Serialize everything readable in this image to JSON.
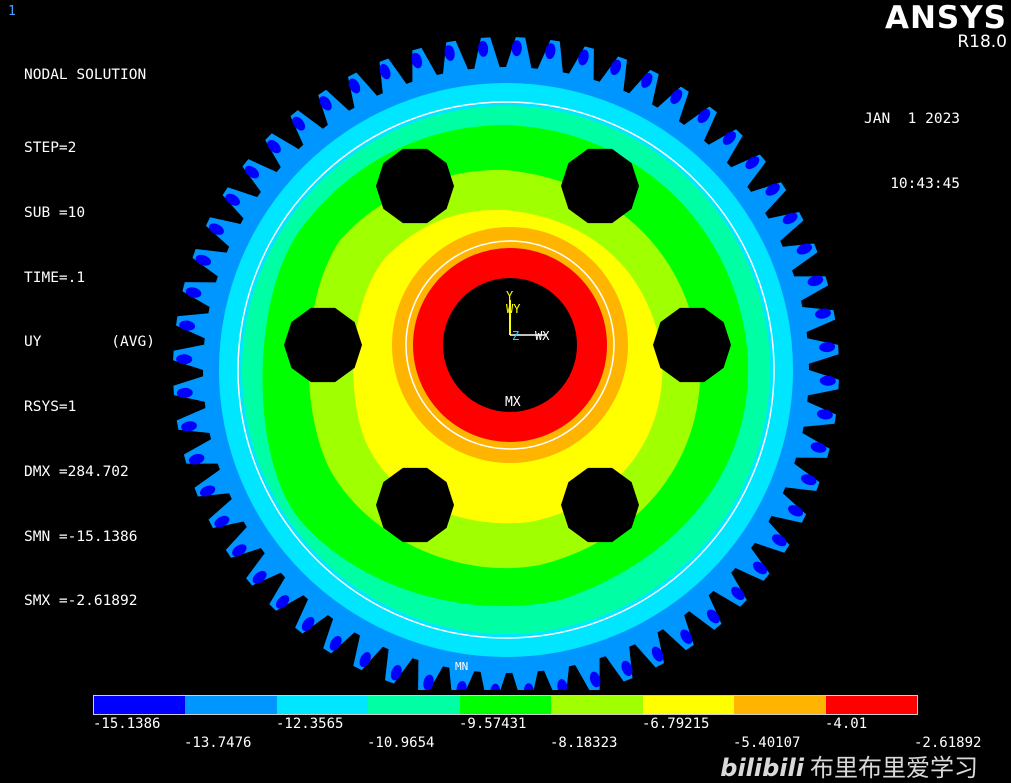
{
  "window_number": "1",
  "info": {
    "title": "NODAL SOLUTION",
    "lines": [
      "STEP=2",
      "SUB =10",
      "TIME=.1",
      "UY        (AVG)",
      "RSYS=1",
      "DMX =284.702",
      "SMN =-15.1386",
      "SMX =-2.61892"
    ]
  },
  "brand": {
    "logo": "ANSYS",
    "version": "R18.0"
  },
  "datetime": {
    "date": "JAN  1 2023",
    "time": "10:43:45"
  },
  "model_labels": {
    "wy": "WY",
    "y": "Y",
    "z": "Z",
    "wx": "WX",
    "mx": "MX",
    "mn": "MN"
  },
  "legend": {
    "colors": [
      "#0000ff",
      "#0096ff",
      "#00e6ff",
      "#00ffa5",
      "#00ff00",
      "#a0ff00",
      "#ffff00",
      "#ffb400",
      "#ff0000"
    ],
    "labels_top": [
      "-15.1386",
      "-12.3565",
      "-9.57431",
      "-6.79215",
      "-4.01"
    ],
    "labels_bottom": [
      "-13.7476",
      "-10.9654",
      "-8.18323",
      "-5.40107",
      "-2.61892"
    ]
  },
  "watermark": {
    "logo": "bilibili",
    "text": "布里布里爱学习"
  }
}
